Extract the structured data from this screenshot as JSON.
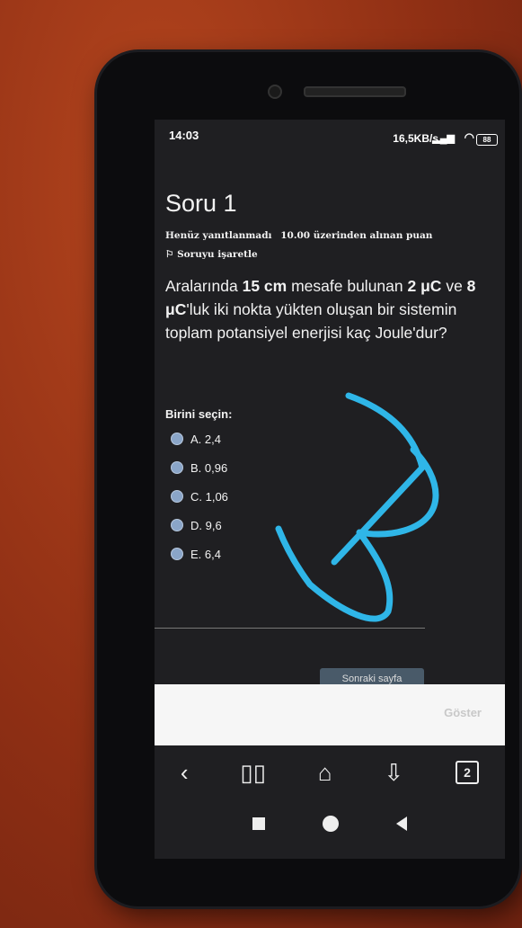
{
  "status": {
    "time": "14:03",
    "network": "16,5KB/s",
    "battery": "88"
  },
  "question": {
    "title": "Soru 1",
    "state": "Henüz yanıtlanmadı",
    "grade": "10.00 üzerinden alınan puan",
    "flag_label": "Soruyu işaretle",
    "text_parts": [
      "Aralarında ",
      "15 cm",
      " mesafe bulunan ",
      "2 μC",
      " ve ",
      "8 μC",
      "'luk iki nokta yükten oluşan bir sistemin toplam potansiyel enerjisi kaç Joule'dur?"
    ],
    "choose_label": "Birini seçin:",
    "options": [
      "A. 2,4",
      "B. 0,96",
      "C. 1,06",
      "D. 9,6",
      "E. 6,4"
    ]
  },
  "next_button": "Sonraki sayfa",
  "toast": {
    "button": "Göster"
  },
  "browser": {
    "tab_count": "2"
  },
  "colors": {
    "scribble": "#2fb6e8"
  }
}
